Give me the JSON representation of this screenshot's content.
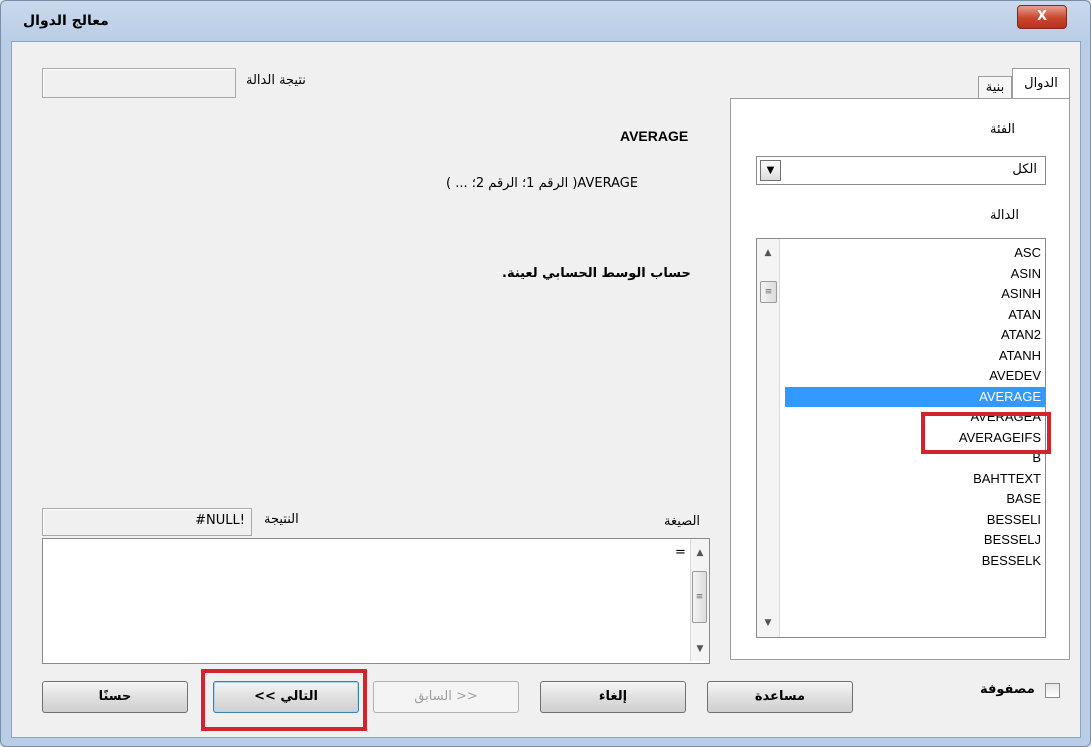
{
  "window": {
    "title": "معالج الدوال",
    "close_label": "X"
  },
  "tabs": [
    {
      "label": "الدوال"
    },
    {
      "label": "بنية"
    }
  ],
  "category": {
    "label": "الفئة",
    "selected": "الكل"
  },
  "function_list": {
    "label": "الدالة",
    "items": [
      "ASC",
      "ASIN",
      "ASINH",
      "ATAN",
      "ATAN2",
      "ATANH",
      "AVEDEV",
      "AVERAGE",
      "AVERAGEA",
      "AVERAGEIFS",
      "B",
      "BAHTTEXT",
      "BASE",
      "BESSELI",
      "BESSELJ",
      "BESSELK"
    ],
    "selected": "AVERAGE"
  },
  "function_result": {
    "label": "نتيجة الدالة",
    "value": ""
  },
  "details": {
    "name": "AVERAGE",
    "syntax": "AVERAGE( الرقم 1؛ الرقم 2؛ ... )",
    "description": "حساب الوسط الحسابي لعينة."
  },
  "formula": {
    "label": "الصيغة",
    "value": "="
  },
  "result": {
    "label": "النتيجة",
    "value": "#NULL!"
  },
  "array_checkbox": {
    "label": "مصفوفة",
    "checked": false
  },
  "buttons": {
    "help": "مساعدة",
    "cancel": "إلغاء",
    "back": "<< السابق",
    "next": "التالي >>",
    "ok": "حسنًا"
  }
}
